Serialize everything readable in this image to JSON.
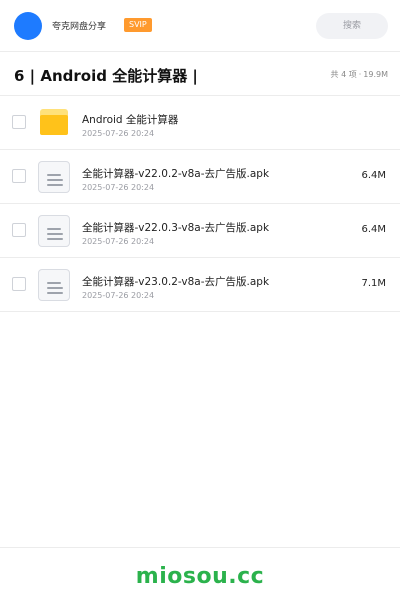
{
  "header": {
    "app_name": "夸克网盘分享",
    "badge": "SVIP",
    "search_placeholder": "搜索"
  },
  "folder": {
    "title": "6 | Android 全能计算器 |",
    "count_label": "共 4 项",
    "separator": "·",
    "total_size": "19.9M"
  },
  "items": [
    {
      "type": "folder",
      "icon": "folder-icon",
      "name": "Android 全能计算器",
      "date": "2025-07-26 20:24",
      "size": ""
    },
    {
      "type": "file",
      "icon": "file-icon",
      "name": "全能计算器-v22.0.2-v8a-去广告版.apk",
      "date": "2025-07-26 20:24",
      "size": "6.4M"
    },
    {
      "type": "file",
      "icon": "file-icon",
      "name": "全能计算器-v22.0.3-v8a-去广告版.apk",
      "date": "2025-07-26 20:24",
      "size": "6.4M"
    },
    {
      "type": "file",
      "icon": "file-icon",
      "name": "全能计算器-v23.0.2-v8a-去广告版.apk",
      "date": "2025-07-26 20:24",
      "size": "7.1M"
    }
  ],
  "footer": {
    "watermark": "miosou.cc"
  },
  "colors": {
    "accent": "#1e7bff",
    "badge": "#ff9a2e",
    "folder": "#ffc21a",
    "watermark": "#2bb24c"
  }
}
